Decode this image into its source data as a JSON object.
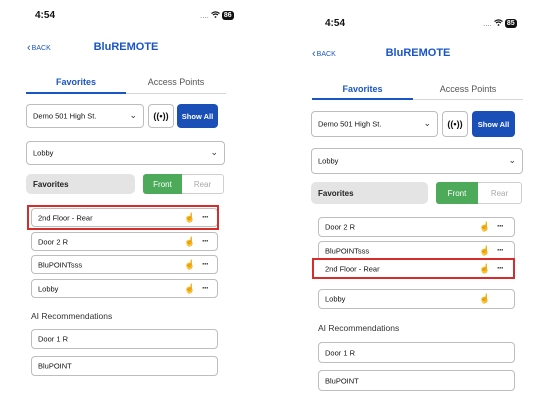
{
  "left": {
    "status": {
      "time": "4:54",
      "signal": "....",
      "battery": "86"
    },
    "back_label": "BACK",
    "title": "BluREMOTE",
    "tabs": [
      {
        "label": "Favorites",
        "active": true
      },
      {
        "label": "Access Points",
        "active": false
      }
    ],
    "site_select": "Demo 501 High St.",
    "broadcast_label": "((•))",
    "show_all_label": "Show All",
    "area_select": "Lobby",
    "favorites_title": "Favorites",
    "front_label": "Front",
    "rear_label": "Rear",
    "favorites": [
      {
        "label": "2nd Floor - Rear",
        "highlighted": true
      },
      {
        "label": "Door 2 R",
        "highlighted": false
      },
      {
        "label": "BluPOINTsss",
        "highlighted": false
      },
      {
        "label": "Lobby",
        "highlighted": false
      }
    ],
    "ai_title": "AI Recommendations",
    "ai": [
      {
        "label": "Door 1 R"
      },
      {
        "label": "BluPOINT"
      }
    ]
  },
  "right": {
    "status": {
      "time": "4:54",
      "signal": "....",
      "battery": "85"
    },
    "back_label": "BACK",
    "title": "BluREMOTE",
    "tabs": [
      {
        "label": "Favorites",
        "active": true
      },
      {
        "label": "Access Points",
        "active": false
      }
    ],
    "site_select": "Demo 501 High St.",
    "broadcast_label": "((•))",
    "show_all_label": "Show All",
    "area_select": "Lobby",
    "favorites_title": "Favorites",
    "front_label": "Front",
    "rear_label": "Rear",
    "favorites": [
      {
        "label": "Door 2 R",
        "highlighted": false
      },
      {
        "label": "BluPOINTsss",
        "highlighted": false
      },
      {
        "label": "2nd Floor - Rear",
        "highlighted": true
      },
      {
        "label": "Lobby",
        "highlighted": false
      }
    ],
    "ai_title": "AI Recommendations",
    "ai": [
      {
        "label": "Door 1 R"
      },
      {
        "label": "BluPOINT"
      }
    ]
  },
  "icons": {
    "hand": "hand-pointer-icon",
    "more": "more-dots-icon",
    "chevron": "chevron-down-icon",
    "back": "chevron-left-icon",
    "wifi": "wifi-icon"
  },
  "colors": {
    "accent": "#1a55c8",
    "show_all": "#1a4fb8",
    "front": "#4caa5a",
    "highlight": "#d62c2c"
  }
}
